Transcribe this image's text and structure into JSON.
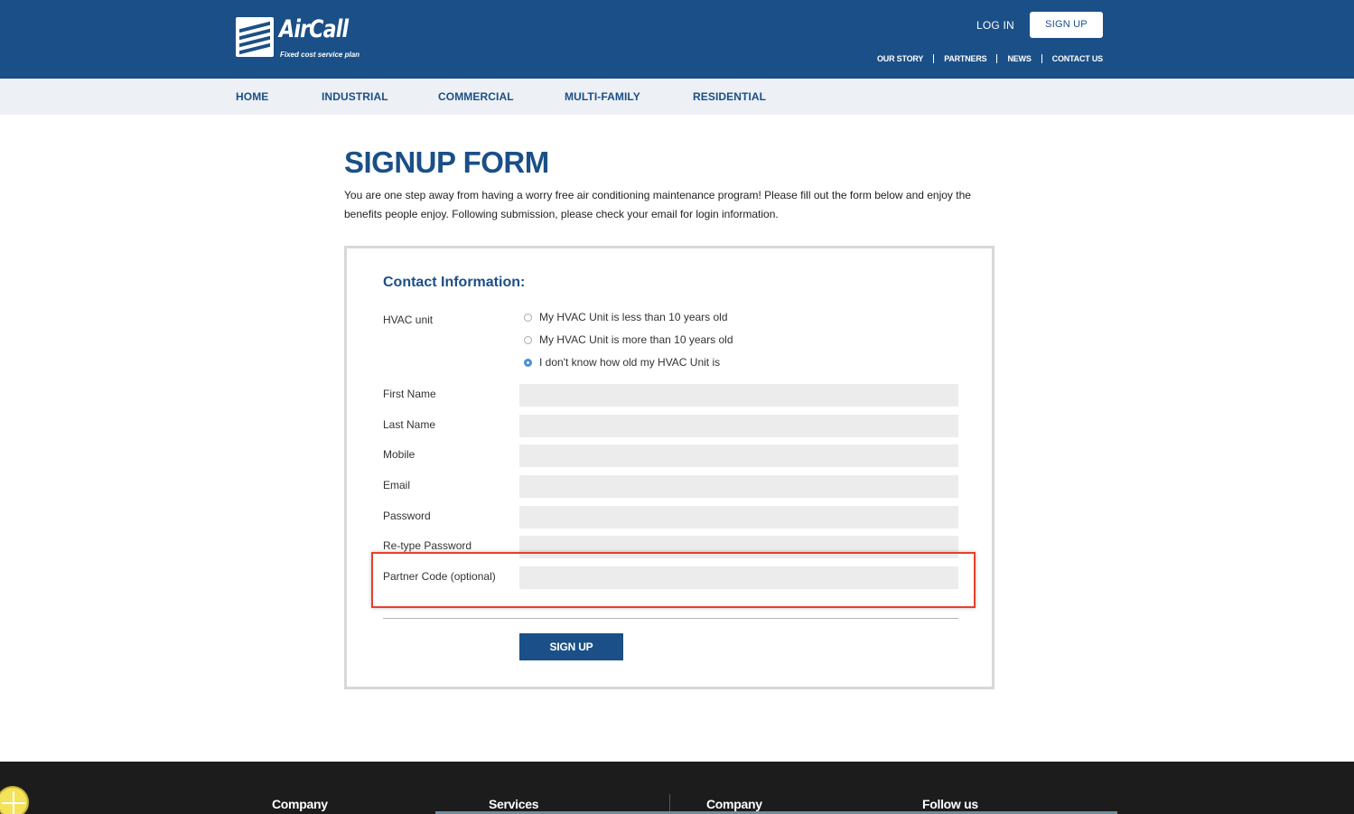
{
  "brand": {
    "name": "AirCall",
    "tagline": "Fixed cost service plan"
  },
  "header": {
    "login_label": "LOG IN",
    "signup_label": "SIGN UP",
    "util_links": [
      "OUR STORY",
      "PARTNERS",
      "NEWS",
      "CONTACT US"
    ]
  },
  "nav": {
    "items": [
      "HOME",
      "INDUSTRIAL",
      "COMMERCIAL",
      "MULTI-FAMILY",
      "RESIDENTIAL"
    ]
  },
  "page": {
    "title": "SIGNUP FORM",
    "intro": "You are one step away from having a worry free air conditioning maintenance program! Please fill out the form below and enjoy the benefits people enjoy. Following submission, please check your email for login information."
  },
  "form": {
    "section_heading": "Contact Information:",
    "hvac": {
      "label": "HVAC unit",
      "options": [
        {
          "label": "My HVAC Unit is less than 10 years old",
          "checked": false
        },
        {
          "label": "My HVAC Unit is more than 10 years old",
          "checked": false
        },
        {
          "label": "I don't know how old my HVAC Unit is",
          "checked": true
        }
      ]
    },
    "fields": {
      "first_name": {
        "label": "First Name",
        "value": ""
      },
      "last_name": {
        "label": "Last Name",
        "value": ""
      },
      "mobile": {
        "label": "Mobile",
        "value": ""
      },
      "email": {
        "label": "Email",
        "value": ""
      },
      "password": {
        "label": "Password",
        "value": ""
      },
      "retype_password": {
        "label": "Re-type Password",
        "value": ""
      },
      "partner_code": {
        "label": "Partner Code (optional)",
        "value": ""
      }
    },
    "submit_label": "SIGN UP"
  },
  "footer": {
    "columns": [
      "Company",
      "Services",
      "Company",
      "Follow us"
    ]
  },
  "colors": {
    "primary": "#1b4f87",
    "nav_bg": "#edf0f4",
    "field_bg": "#ececec",
    "highlight": "#e8402a",
    "footer_bg": "#1c1c1c"
  }
}
